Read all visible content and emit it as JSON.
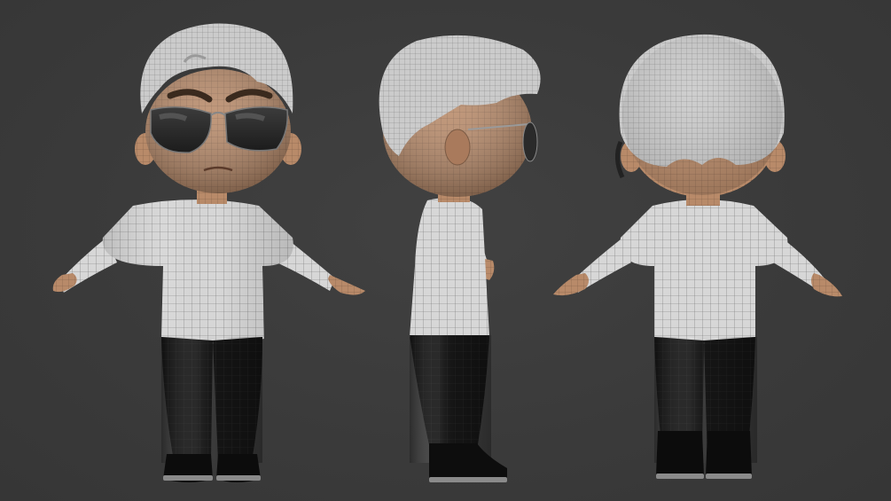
{
  "scene": {
    "background_color": "#3b3b3b",
    "views": [
      {
        "label": "front"
      },
      {
        "label": "side"
      },
      {
        "label": "back"
      }
    ]
  },
  "materials": {
    "skin": "#b98a6a",
    "hair": "#c8c8c8",
    "shirt": "#d9d9d9",
    "pants": "#111111",
    "lens": "#2a2a2a",
    "wire": "#6a6a6a"
  }
}
